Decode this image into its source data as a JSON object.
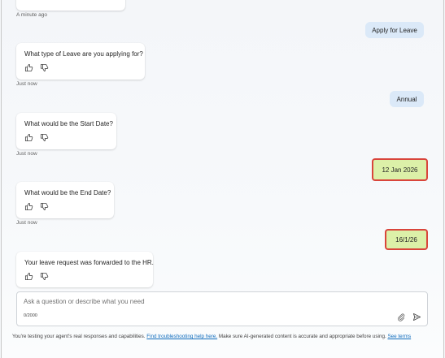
{
  "messages": [
    {
      "role": "bot",
      "text": "",
      "timestamp": "A minute ago"
    },
    {
      "role": "user",
      "text": "Apply for Leave"
    },
    {
      "role": "bot",
      "text": "What type of Leave are you applying for?",
      "timestamp": "Just now"
    },
    {
      "role": "user",
      "text": "Annual"
    },
    {
      "role": "bot",
      "text": "What would be the Start Date?",
      "timestamp": "Just now"
    },
    {
      "role": "user",
      "text": "12 Jan 2026",
      "highlighted": true
    },
    {
      "role": "bot",
      "text": "What would be the End Date?",
      "timestamp": "Just now"
    },
    {
      "role": "user",
      "text": "16/1/26",
      "highlighted": true
    },
    {
      "role": "bot",
      "text": "Your leave request was forwarded to the HR."
    }
  ],
  "composer": {
    "placeholder": "Ask a question or describe what you need",
    "char_count": "0/2000"
  },
  "footer": {
    "text_before": "You're testing your agent's real responses and capabilities. ",
    "link1": "Find troubleshooting help here.",
    "text_middle": " Make sure AI-generated content is accurate and appropriate before using. ",
    "link2": "See terms"
  },
  "icons": {
    "like": "thumbs-up-icon",
    "dislike": "thumbs-down-icon",
    "attach": "paperclip-icon",
    "send": "send-icon"
  },
  "colors": {
    "user_bubble": "#dbe9f8",
    "highlight_fill": "#dcf0a8",
    "highlight_border": "#d9453b",
    "link": "#0f6cbd"
  }
}
